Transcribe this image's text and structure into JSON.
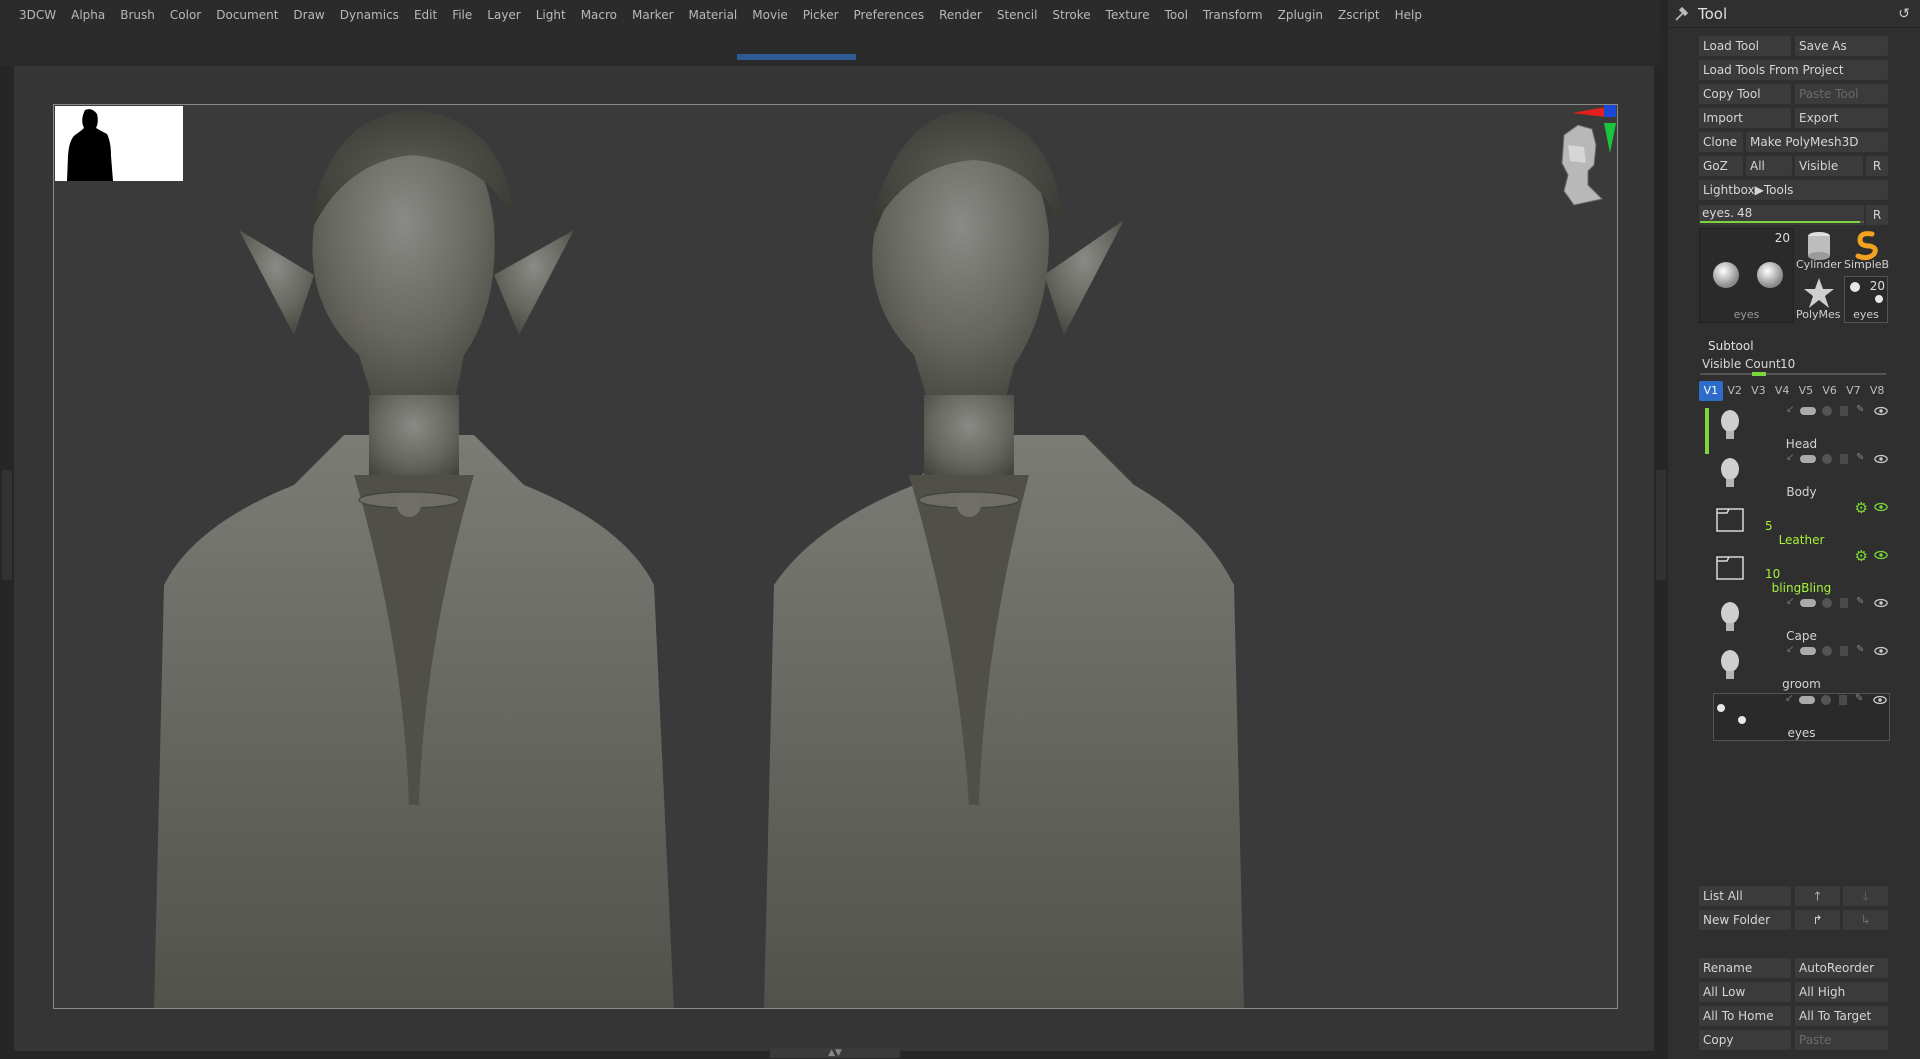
{
  "menu": [
    "3DCW",
    "Alpha",
    "Brush",
    "Color",
    "Document",
    "Draw",
    "Dynamics",
    "Edit",
    "File",
    "Layer",
    "Light",
    "Macro",
    "Marker",
    "Material",
    "Movie",
    "Picker",
    "Preferences",
    "Render",
    "Stencil",
    "Stroke",
    "Texture",
    "Tool",
    "Transform",
    "Zplugin",
    "Zscript",
    "Help"
  ],
  "tool_panel": {
    "title": "Tool",
    "buttons": {
      "load_tool": "Load Tool",
      "save_as": "Save As",
      "load_tools_from_project": "Load Tools From Project",
      "copy_tool": "Copy Tool",
      "paste_tool": "Paste Tool",
      "import": "Import",
      "export": "Export",
      "clone": "Clone",
      "make_polymesh": "Make PolyMesh3D",
      "goz": "GoZ",
      "all": "All",
      "visible": "Visible",
      "r": "R",
      "lightbox_tools": "Lightbox▶Tools"
    },
    "current_tool": {
      "label": "eyes.",
      "value": "48",
      "fill": 0.97,
      "r": "R"
    },
    "thumbs": {
      "main_label": "eyes",
      "main_count": "20",
      "cylinder": "Cylinder",
      "simpleb": "SimpleB",
      "polymesh": "PolyMes",
      "eyes_small": "eyes",
      "eyes_small_count": "20"
    }
  },
  "subtool": {
    "title": "Subtool",
    "visible_count_label": "Visible Count",
    "visible_count_value": "10",
    "versions": [
      "V1",
      "V2",
      "V3",
      "V4",
      "V5",
      "V6",
      "V7",
      "V8"
    ],
    "items": [
      {
        "name": "Head",
        "type": "mesh",
        "count": ""
      },
      {
        "name": "Body",
        "type": "mesh",
        "count": ""
      },
      {
        "name": "Leather",
        "type": "folder",
        "count": "5"
      },
      {
        "name": "blingBling",
        "type": "folder",
        "count": "10"
      },
      {
        "name": "Cape",
        "type": "mesh",
        "count": ""
      },
      {
        "name": "groom",
        "type": "mesh",
        "count": ""
      },
      {
        "name": "eyes",
        "type": "mesh",
        "count": ""
      }
    ],
    "buttons": {
      "list_all": "List All",
      "new_folder": "New Folder",
      "rename": "Rename",
      "auto_reorder": "AutoReorder",
      "all_low": "All Low",
      "all_high": "All High",
      "all_to_home": "All To Home",
      "all_to_target": "All To Target",
      "copy": "Copy",
      "paste": "Paste"
    }
  },
  "colors": {
    "accent_green": "#7ad63a",
    "accent_blue": "#2d6cc9",
    "panel_bg": "#2f2f2f",
    "canvas_bg": "#3a3a3a"
  }
}
